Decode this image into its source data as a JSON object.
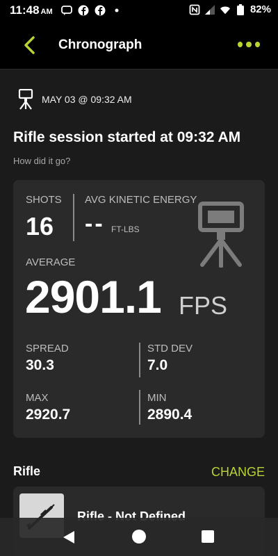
{
  "status": {
    "time": "11:48",
    "ampm": "AM",
    "battery": "82%"
  },
  "header": {
    "title": "Chronograph"
  },
  "session": {
    "date": "MAY 03 @ 09:32 AM",
    "title": "Rifle session started at 09:32 AM",
    "subtitle": "How did it go?"
  },
  "stats": {
    "shots_label": "SHOTS",
    "shots_value": "16",
    "ke_label": "AVG KINETIC ENERGY",
    "ke_value": "--",
    "ke_unit": "FT-LBS",
    "average_label": "AVERAGE",
    "average_value": "2901.1",
    "average_unit": "FPS",
    "spread_label": "SPREAD",
    "spread_value": "30.3",
    "stddev_label": "STD DEV",
    "stddev_value": "7.0",
    "max_label": "MAX",
    "max_value": "2920.7",
    "min_label": "MIN",
    "min_value": "2890.4"
  },
  "rifle": {
    "header": "Rifle",
    "change_label": "CHANGE",
    "name": "Rifle - Not Defined"
  },
  "colors": {
    "accent": "#b9d334",
    "background": "#1b1b1b",
    "card": "#2a2a2a"
  }
}
